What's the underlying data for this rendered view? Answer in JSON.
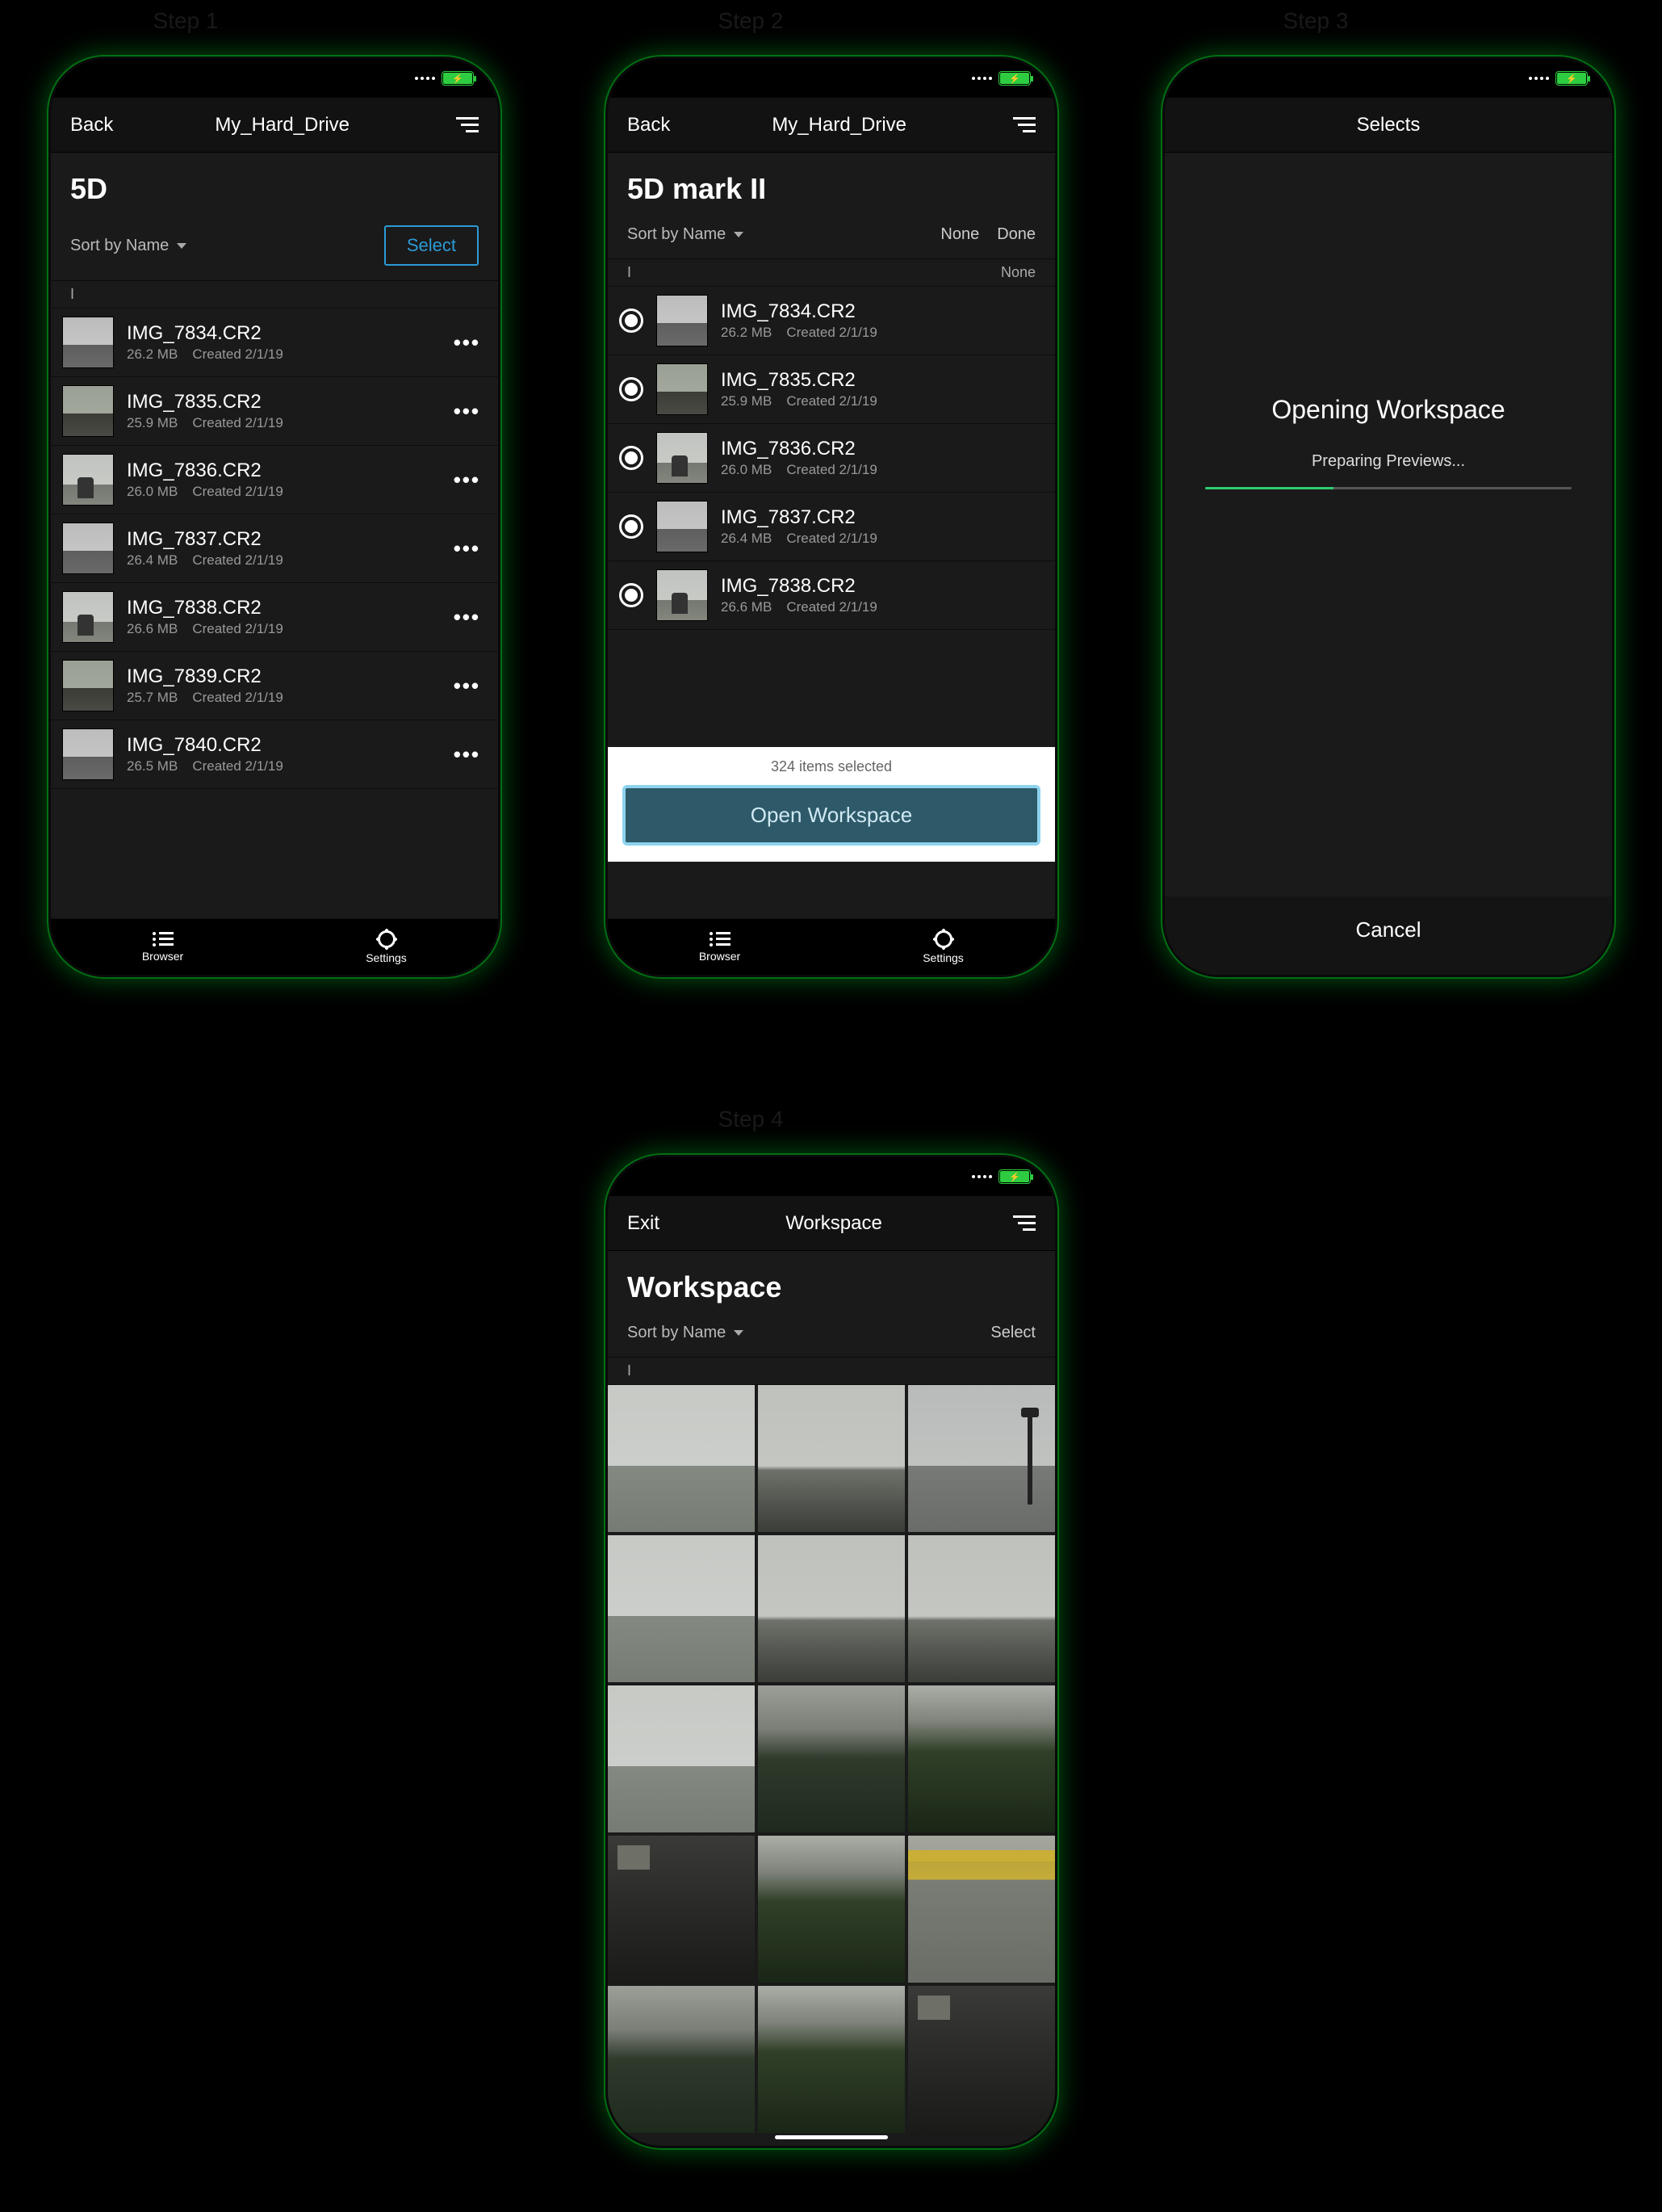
{
  "step_labels": {
    "s1": "Step 1",
    "s2": "Step 2",
    "s3": "Step 3",
    "s4": "Step 4"
  },
  "common": {
    "back": "Back",
    "exit": "Exit",
    "sort_label": "Sort by Name",
    "select": "Select",
    "none": "None",
    "done": "Done",
    "tab_browser": "Browser",
    "tab_settings": "Settings",
    "section_letter": "I",
    "more": "•••"
  },
  "step1": {
    "nav_title": "My_Hard_Drive",
    "folder": "5D",
    "files": [
      {
        "name": "IMG_7834.CR2",
        "size": "26.2 MB",
        "date": "Created 2/1/19"
      },
      {
        "name": "IMG_7835.CR2",
        "size": "25.9 MB",
        "date": "Created 2/1/19"
      },
      {
        "name": "IMG_7836.CR2",
        "size": "26.0 MB",
        "date": "Created 2/1/19"
      },
      {
        "name": "IMG_7837.CR2",
        "size": "26.4 MB",
        "date": "Created 2/1/19"
      },
      {
        "name": "IMG_7838.CR2",
        "size": "26.6 MB",
        "date": "Created 2/1/19"
      },
      {
        "name": "IMG_7839.CR2",
        "size": "25.7 MB",
        "date": "Created 2/1/19"
      },
      {
        "name": "IMG_7840.CR2",
        "size": "26.5 MB",
        "date": "Created 2/1/19"
      }
    ]
  },
  "step2": {
    "nav_title": "My_Hard_Drive",
    "folder": "5D mark II",
    "head_right": "None",
    "files": [
      {
        "name": "IMG_7834.CR2",
        "size": "26.2 MB",
        "date": "Created 2/1/19"
      },
      {
        "name": "IMG_7835.CR2",
        "size": "25.9 MB",
        "date": "Created 2/1/19"
      },
      {
        "name": "IMG_7836.CR2",
        "size": "26.0 MB",
        "date": "Created 2/1/19"
      },
      {
        "name": "IMG_7837.CR2",
        "size": "26.4 MB",
        "date": "Created 2/1/19"
      },
      {
        "name": "IMG_7838.CR2",
        "size": "26.6 MB",
        "date": "Created 2/1/19"
      }
    ],
    "selected_count": "324 items selected",
    "open_ws": "Open Workspace"
  },
  "step3": {
    "nav_title": "Selects",
    "loading_title": "Opening Workspace",
    "loading_sub": "Preparing Previews...",
    "cancel": "Cancel"
  },
  "step4": {
    "nav_title": "Workspace",
    "folder": "Workspace"
  }
}
